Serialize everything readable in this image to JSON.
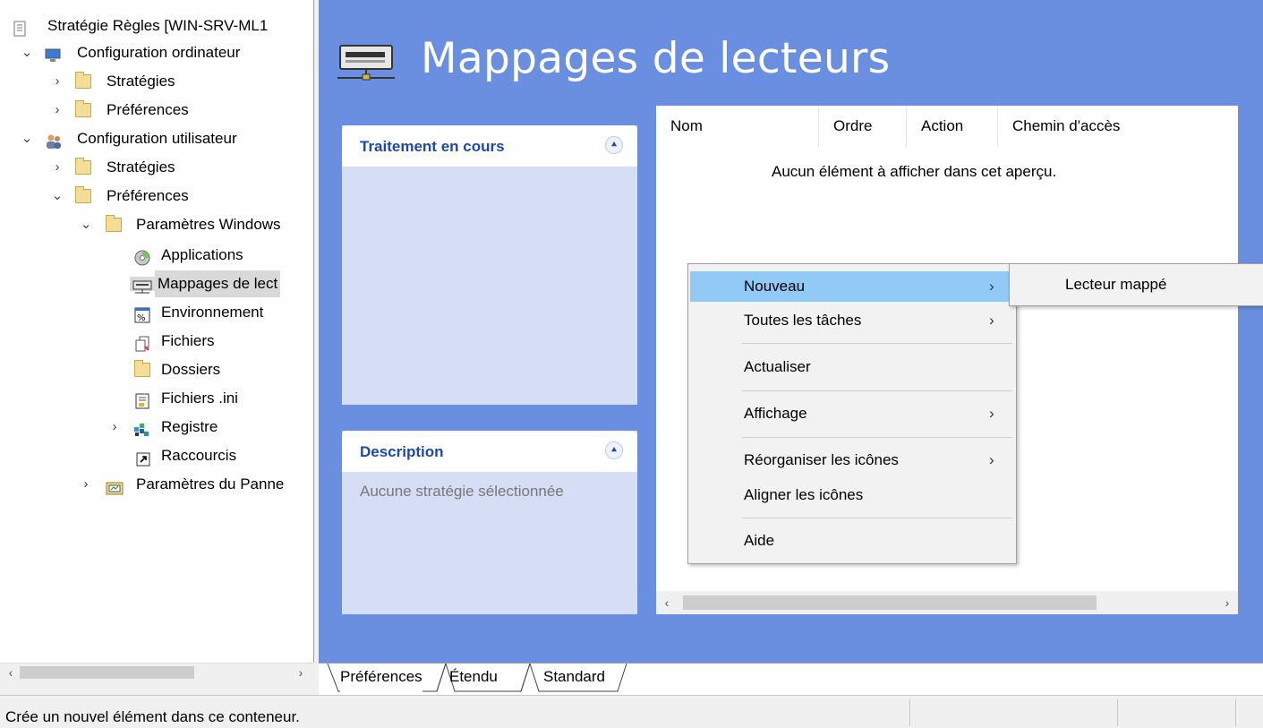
{
  "tree": {
    "root": "Stratégie Règles [WIN-SRV-ML1",
    "computer_config": "Configuration ordinateur",
    "cc_strategies": "Stratégies",
    "cc_preferences": "Préférences",
    "user_config": "Configuration utilisateur",
    "uc_strategies": "Stratégies",
    "uc_preferences": "Préférences",
    "windows_settings": "Paramètres Windows",
    "applications": "Applications",
    "drive_maps": "Mappages de lect",
    "environment": "Environnement",
    "files": "Fichiers",
    "folders": "Dossiers",
    "ini_files": "Fichiers .ini",
    "registry": "Registre",
    "shortcuts": "Raccourcis",
    "control_panel": "Paramètres du Panne"
  },
  "header": {
    "title": "Mappages de lecteurs"
  },
  "panels": {
    "processing": "Traitement en cours",
    "description": "Description",
    "description_text": "Aucune stratégie sélectionnée"
  },
  "listview": {
    "columns": [
      "Nom",
      "Ordre",
      "Action",
      "Chemin d'accès"
    ],
    "empty_message": "Aucun élément à afficher dans cet aperçu."
  },
  "context_menu": {
    "items": [
      "Nouveau",
      "Toutes les tâches",
      "Actualiser",
      "Affichage",
      "Réorganiser les icônes",
      "Aligner les icônes",
      "Aide"
    ],
    "submenu_item": "Lecteur mappé"
  },
  "tabs": [
    "Préférences",
    "Étendu",
    "Standard"
  ],
  "status": {
    "text": "Crée un nouvel élément dans ce conteneur."
  },
  "colors": {
    "pane_bg": "#6a8fe0",
    "panel_title": "#1e49a8",
    "menu_highlight": "#91c9f7"
  }
}
